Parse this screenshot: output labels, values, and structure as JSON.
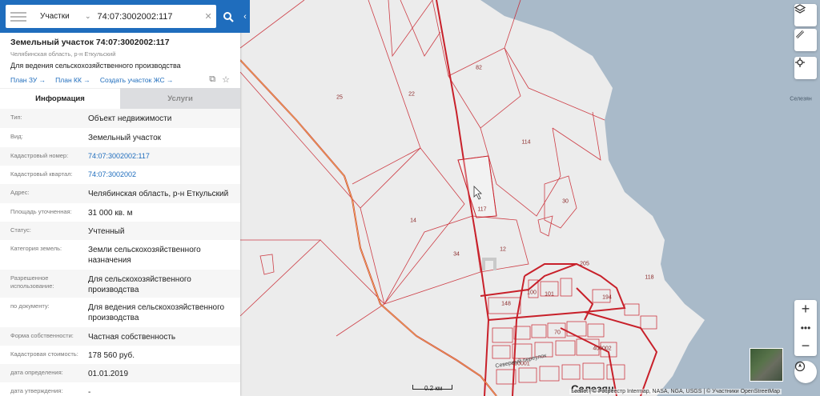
{
  "search": {
    "category": "Участки",
    "value": "74:07:3002002:117"
  },
  "object": {
    "title": "Земельный участок 74:07:3002002:117",
    "subtitle": "Челябинская область, р-н Еткульский",
    "purpose": "Для ведения сельскохозяйственного производства",
    "links": [
      "План ЗУ",
      "План КК",
      "Создать участок ЖС"
    ]
  },
  "tabs": [
    "Информация",
    "Услуги"
  ],
  "attributes": [
    {
      "label": "Тип:",
      "value": "Объект недвижимости"
    },
    {
      "label": "Вид:",
      "value": "Земельный участок"
    },
    {
      "label": "Кадастровый номер:",
      "value": "74:07:3002002:117"
    },
    {
      "label": "Кадастровый квартал:",
      "value": "74:07:3002002"
    },
    {
      "label": "Адрес:",
      "value": "Челябинская область, р-н Еткульский"
    },
    {
      "label": "Площадь уточненная:",
      "value": "31 000 кв. м"
    },
    {
      "label": "Статус:",
      "value": "Учтенный"
    },
    {
      "label": "Категория земель:",
      "value": "Земли сельскохозяйственного назначения"
    },
    {
      "label": "Разрешенное использование:",
      "value": "Для сельскохозяйственного производства"
    },
    {
      "label": "по документу:",
      "value": "Для ведения сельскохозяйственного производства"
    },
    {
      "label": "Форма собственности:",
      "value": "Частная собственность"
    },
    {
      "label": "Кадастровая стоимость:",
      "value": "178 560 руб."
    },
    {
      "label": "дата определения:",
      "value": "01.01.2019"
    },
    {
      "label": "дата утверждения:",
      "value": "-"
    }
  ],
  "map": {
    "parcel_labels": [
      "82",
      "25",
      "22",
      "114",
      "117",
      "30",
      "14",
      "12",
      "34",
      "205",
      "118",
      "148",
      "100",
      "101",
      "194",
      "70",
      "400002",
      "400001"
    ],
    "town_label": "Селезян",
    "lake_label": "Селезян",
    "street_label": "Северный переулок",
    "scale": "0.2 км",
    "attribution": "Leaflet | © Росреестр  Intermap, NASA, NGA, USGS | © Участники OpenStreetMap"
  },
  "colors": {
    "header_blue": "#1f6dbd",
    "parcel_red": "#c8202a",
    "water": "#a9bac9",
    "road": "#f0b95a"
  }
}
